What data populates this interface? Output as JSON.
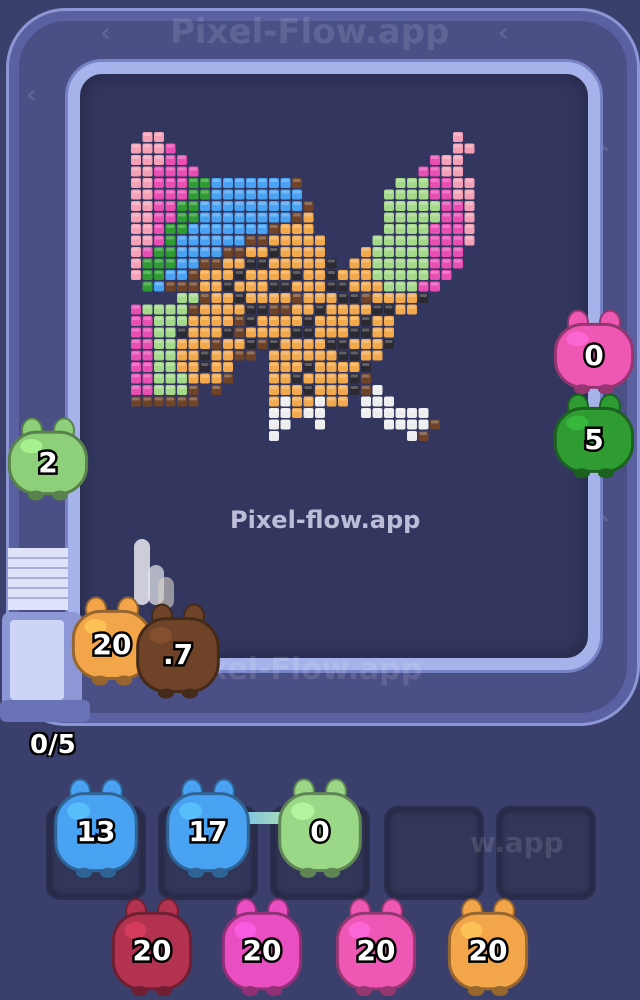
{
  "watermark": {
    "top": "Pixel-Flow.app",
    "center": "Pixel-flow.app",
    "bottom": "xel-Flow.app",
    "slot_row": "w.app"
  },
  "counter": "0/5",
  "track_creatures": {
    "left": {
      "value": "2",
      "color": "#8ed07a"
    },
    "right_top": {
      "value": "0",
      "color": "#ee58b4"
    },
    "right_bottom": {
      "value": "5",
      "color": "#2f9c33"
    },
    "bottom_orange": {
      "value": "20",
      "color": "#f3a54a"
    },
    "bottom_brown": {
      "value": ".7",
      "color": "#6e4328"
    }
  },
  "slots": [
    {
      "value": "13",
      "color": "#4aa2f2"
    },
    {
      "value": "17",
      "color": "#4aa2f2"
    },
    {
      "value": "0",
      "color": "#9ad888"
    },
    {
      "value": "",
      "color": ""
    },
    {
      "value": "",
      "color": ""
    }
  ],
  "queue": [
    {
      "value": "20",
      "color": "#b3324f"
    },
    {
      "value": "20",
      "color": "#e94fc0"
    },
    {
      "value": "20",
      "color": "#ee58b4"
    },
    {
      "value": "20",
      "color": "#f3a54a"
    }
  ],
  "palette": {
    "lightpink": "#f4a0b6",
    "pink": "#e94fb2",
    "green": "#2f9c33",
    "lightgreen": "#a5d98a",
    "blue": "#4aa2f2",
    "orange": "#f2a94c",
    "brown": "#6e4328",
    "black": "#2a2a30",
    "white": "#eeeeee"
  }
}
